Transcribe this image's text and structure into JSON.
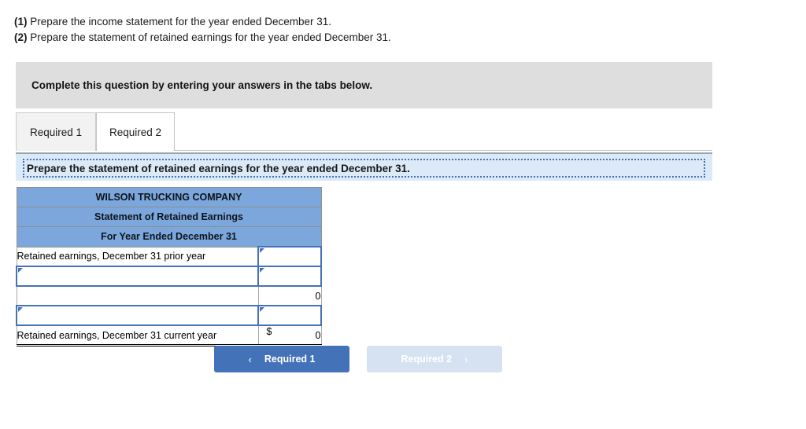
{
  "prompt": {
    "line1_num": "(1)",
    "line1_text": "Prepare the income statement for the year ended December 31.",
    "line2_num": "(2)",
    "line2_text": "Prepare the statement of retained earnings for the year ended December 31."
  },
  "banner": {
    "text": "Complete this question by entering your answers in the tabs below."
  },
  "tabs": [
    {
      "label": "Required 1",
      "active": false
    },
    {
      "label": "Required 2",
      "active": true
    }
  ],
  "instruction": {
    "text": "Prepare the statement of retained earnings for the year ended December 31."
  },
  "worksheet": {
    "headers": [
      "WILSON TRUCKING COMPANY",
      "Statement of Retained Earnings",
      "For Year Ended December 31"
    ],
    "rows": [
      {
        "label": "Retained earnings, December 31 prior year",
        "label_editable": false,
        "value": "",
        "value_editable": true,
        "currency": ""
      },
      {
        "label": "",
        "label_editable": true,
        "value": "",
        "value_editable": true,
        "currency": ""
      },
      {
        "label": "",
        "label_editable": false,
        "value": "0",
        "value_editable": false,
        "currency": ""
      },
      {
        "label": "",
        "label_editable": true,
        "value": "",
        "value_editable": true,
        "currency": ""
      },
      {
        "label": "Retained earnings, December 31 current year",
        "label_editable": false,
        "value": "0",
        "value_editable": false,
        "currency": "$"
      }
    ]
  },
  "navigation": {
    "prev_label": "Required 1",
    "prev_chevron": "‹",
    "next_label": "Required 2",
    "next_chevron": "›"
  },
  "colors": {
    "header_blue": "#7ba7dd",
    "accent_blue": "#4472b8",
    "banner_gray": "#dedede",
    "instruction_blue": "#dce9f7",
    "disabled_blue": "#d6e2f2"
  }
}
